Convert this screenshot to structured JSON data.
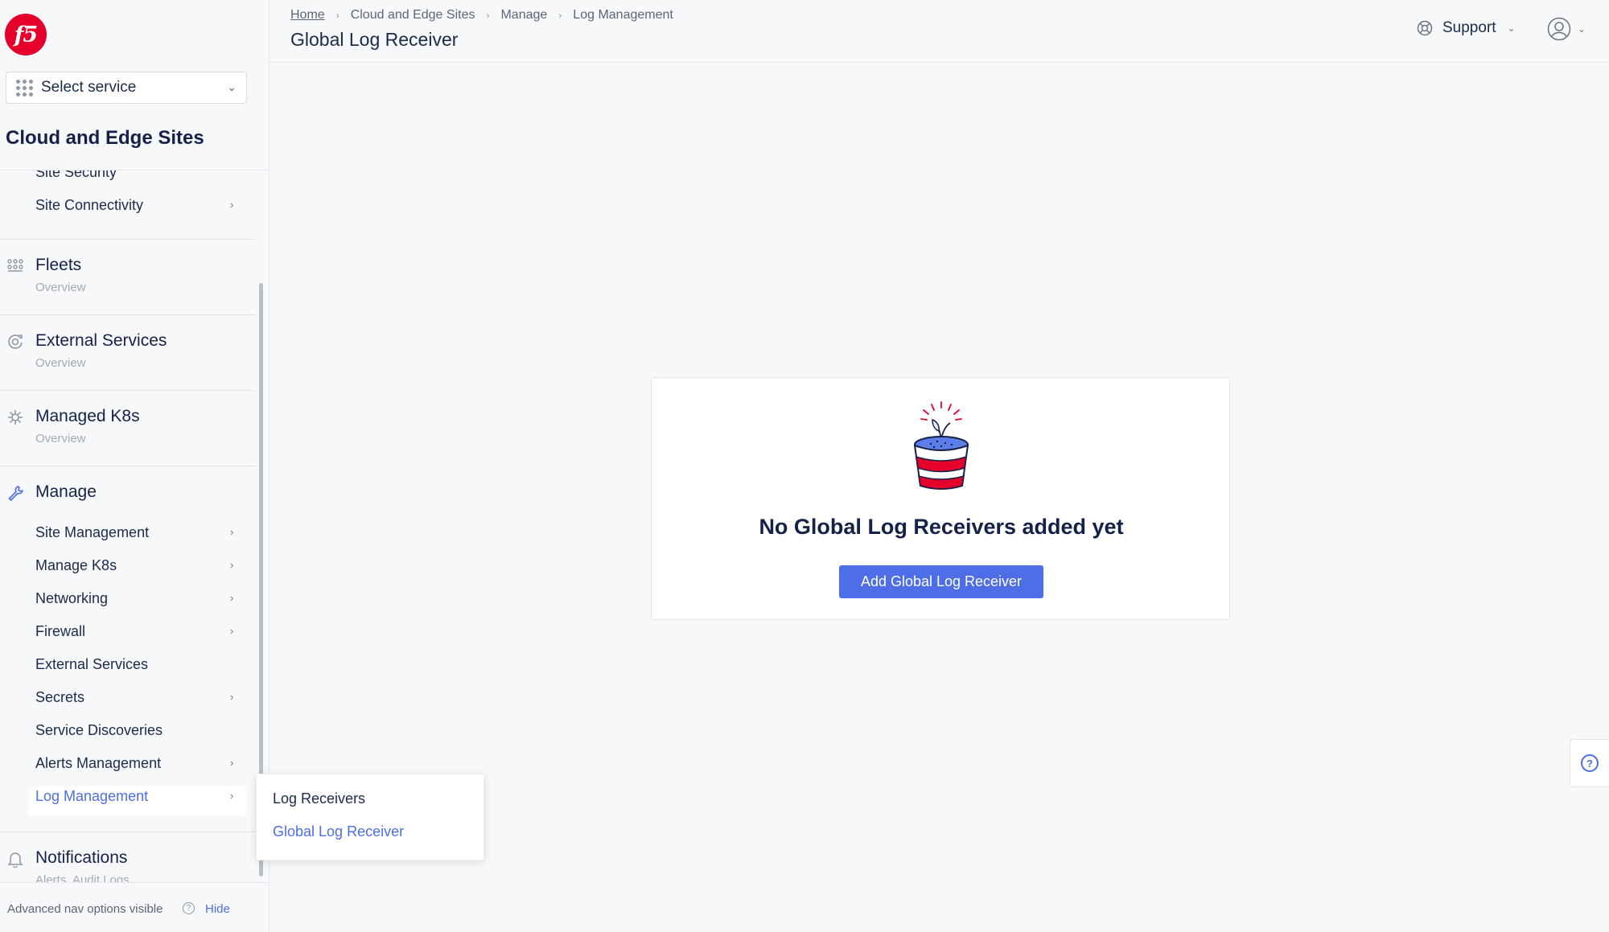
{
  "brand": {
    "logo_text": "f5"
  },
  "service_select": {
    "label": "Select service"
  },
  "workspace": {
    "title": "Cloud and Edge Sites"
  },
  "nav": {
    "site_security": "Site Security",
    "site_connectivity": "Site Connectivity",
    "fleets": {
      "title": "Fleets",
      "sub": "Overview"
    },
    "external_services": {
      "title": "External Services",
      "sub": "Overview"
    },
    "managed_k8s": {
      "title": "Managed K8s",
      "sub": "Overview"
    },
    "manage": {
      "title": "Manage",
      "items": [
        {
          "label": "Site Management",
          "chevron": true
        },
        {
          "label": "Manage K8s",
          "chevron": true
        },
        {
          "label": "Networking",
          "chevron": true
        },
        {
          "label": "Firewall",
          "chevron": true
        },
        {
          "label": "External Services",
          "chevron": false
        },
        {
          "label": "Secrets",
          "chevron": true
        },
        {
          "label": "Service Discoveries",
          "chevron": false
        },
        {
          "label": "Alerts Management",
          "chevron": true
        },
        {
          "label": "Log Management",
          "chevron": true,
          "active": true
        }
      ]
    },
    "notifications": {
      "title": "Notifications",
      "sub": "Alerts, Audit Logs"
    }
  },
  "footer": {
    "text": "Advanced nav options visible",
    "hide_label": "Hide"
  },
  "header": {
    "breadcrumb": [
      "Home",
      "Cloud and Edge Sites",
      "Manage",
      "Log Management"
    ],
    "title": "Global Log Receiver",
    "support_label": "Support"
  },
  "empty_state": {
    "title": "No Global Log Receivers added yet",
    "button_label": "Add Global Log Receiver"
  },
  "flyout": {
    "items": [
      {
        "label": "Log Receivers",
        "active": false
      },
      {
        "label": "Global Log Receiver",
        "active": true
      }
    ]
  },
  "colors": {
    "accent": "#4d6ee6",
    "brand": "#e4002b",
    "heading": "#16214a"
  }
}
